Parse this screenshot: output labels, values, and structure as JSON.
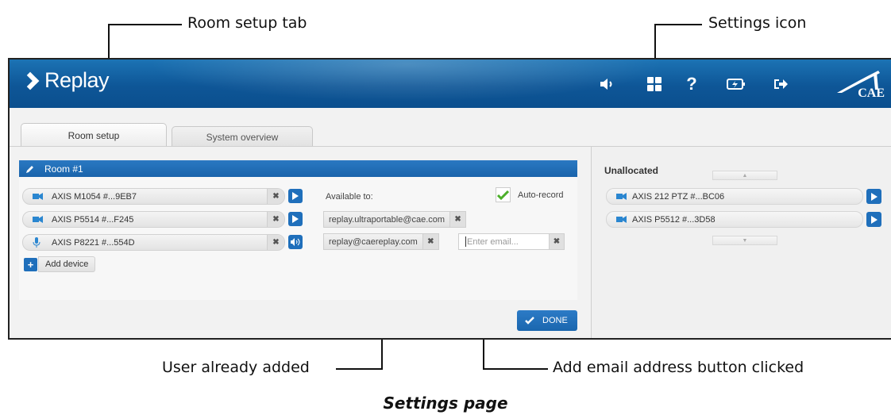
{
  "callouts": {
    "room_setup_tab": "Room setup tab",
    "settings_icon": "Settings icon",
    "user_already_added": "User already added",
    "add_email_clicked": "Add email address button clicked",
    "caption": "Settings page"
  },
  "header": {
    "app_name": "Replay",
    "brand_logo_text": "CAE",
    "icons": [
      "speaker-icon",
      "settings-icon",
      "help-icon",
      "battery-icon",
      "logout-icon"
    ],
    "background_color": "#0e5697"
  },
  "tabs": [
    {
      "label": "Room setup",
      "active": true
    },
    {
      "label": "System overview",
      "active": false
    }
  ],
  "room": {
    "title": "Room #1",
    "devices": [
      {
        "icon": "camera-icon",
        "name": "AXIS M1054 #...9EB7",
        "action_icon": "play-icon"
      },
      {
        "icon": "camera-icon",
        "name": "AXIS P5514 #...F245",
        "action_icon": "play-icon"
      },
      {
        "icon": "microphone-icon",
        "name": "AXIS P8221 #...554D",
        "action_icon": "speaker-icon"
      }
    ],
    "add_device_label": "Add device",
    "available_to_label": "Available to:",
    "auto_record_label": "Auto-record",
    "auto_record_checked": true,
    "users": [
      "replay.ultraportable@cae.com",
      "replay@caereplay.com"
    ],
    "email_placeholder": "Enter email...",
    "done_label": "DONE",
    "accent_color": "#1f6fbb"
  },
  "unallocated": {
    "title": "Unallocated",
    "devices": [
      {
        "icon": "camera-icon",
        "name": "AXIS 212 PTZ #...BC06"
      },
      {
        "icon": "camera-icon",
        "name": "AXIS P5512 #...3D58"
      }
    ]
  }
}
